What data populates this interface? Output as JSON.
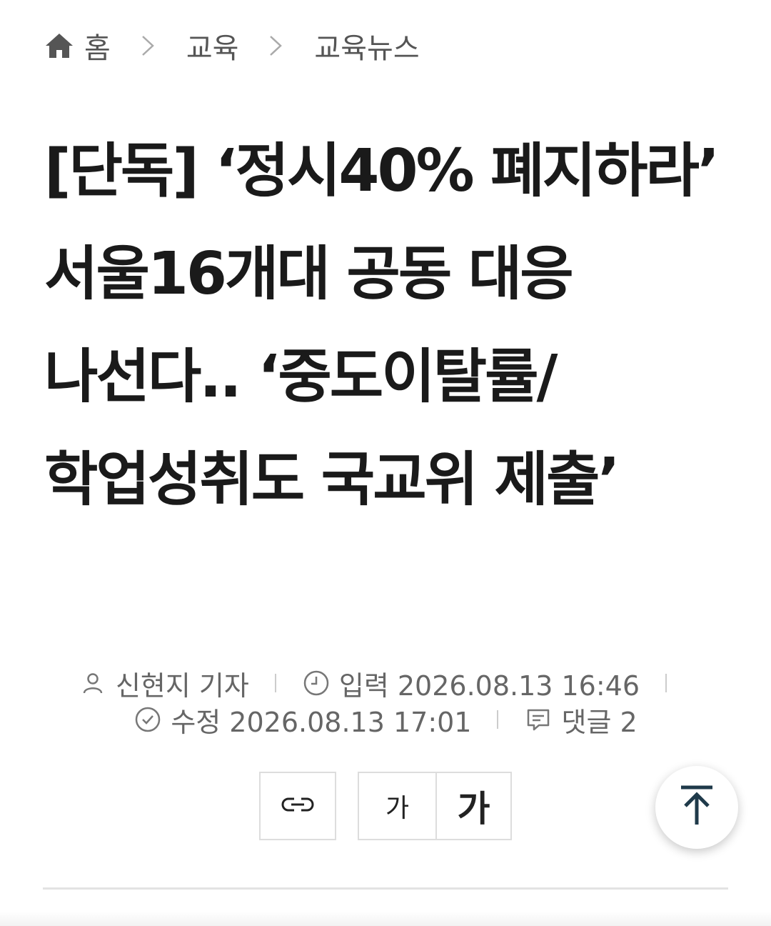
{
  "breadcrumb": {
    "home_icon": "home-icon",
    "home_label": "홈",
    "separator_icon": "chevron-right-icon",
    "level1": "교육",
    "level2": "교육뉴스"
  },
  "article": {
    "title": "[단독] ‘정시40% 폐지하라’ 서울16개대 공동 대응 나선다.. ‘중도이탈률/학업성취도 국교위 제출’"
  },
  "meta": {
    "author_icon": "person-icon",
    "author": "신현지 기자",
    "published_icon": "clock-icon",
    "published": "입력 2026.08.13 16:46",
    "modified_icon": "check-circle-icon",
    "modified": "수정 2026.08.13 17:01",
    "comments_icon": "comment-icon",
    "comments": "댓글 2"
  },
  "tools": {
    "link_icon": "link-icon",
    "font_small": "가",
    "font_large": "가",
    "to_top_icon": "arrow-up-icon"
  }
}
